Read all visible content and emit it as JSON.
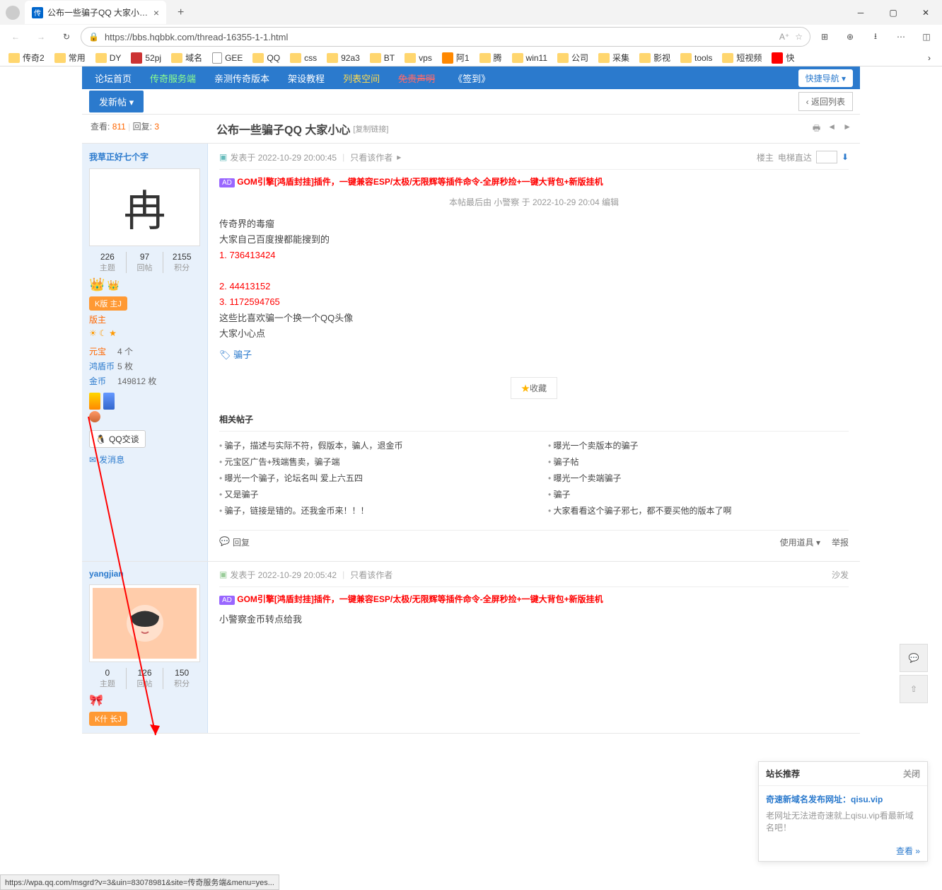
{
  "browser": {
    "tab_title": "公布一些骗子QQ 大家小心-传奇",
    "url": "https://bbs.hqbbk.com/thread-16355-1-1.html",
    "bookmarks": [
      "传奇2",
      "常用",
      "DY",
      "52pj",
      "域名",
      "GEE",
      "QQ",
      "css",
      "92a3",
      "BT",
      "vps",
      "阿1",
      "腾",
      "win11",
      "公司",
      "采集",
      "影视",
      "tools",
      "短视频",
      "快"
    ]
  },
  "forum_nav": {
    "home": "论坛首页",
    "svc": "传奇服务端",
    "test": "亲测传奇版本",
    "setup": "架设教程",
    "space": "列表空间",
    "declare": "免责声明",
    "signin": "《签到》",
    "quick": "快捷导航"
  },
  "subnav": {
    "newpost": "发新帖",
    "return": "‹ 返回列表"
  },
  "stats": {
    "view_lbl": "查看:",
    "view_num": "811",
    "reply_lbl": "回复:",
    "reply_num": "3",
    "title": "公布一些骗子QQ 大家小心",
    "copy": "[复制链接]"
  },
  "post1": {
    "username": "我草正好七个字",
    "date": "发表于 2022-10-29 20:00:45",
    "only_author": "只看该作者",
    "floor": "楼主",
    "elevator": "电梯直达",
    "ad": "GOM引擎[鸿盾封挂]插件，一键兼容ESP/太极/无限辉等插件命令-全屏秒捡+一键大背包+新版挂机",
    "edit_note": "本帖最后由 小警察 于 2022-10-29 20:04 编辑",
    "line1": "传奇界的毒瘤",
    "line2": "大家自己百度搜都能搜到的",
    "qq1": "1. 736413424",
    "qq2": "2. 44413152",
    "qq3": "3. 1172594765",
    "line3": "这些比喜欢骗一个换一个QQ头像",
    "line4": "大家小心点",
    "tag": "骗子",
    "fav": "收藏",
    "stats": {
      "threads": "226",
      "replies": "97",
      "points": "2155",
      "lbl_t": "主题",
      "lbl_r": "回帖",
      "lbl_p": "积分"
    },
    "badge": "K版 主J",
    "role": "版主",
    "props": {
      "yuanbao_k": "元宝",
      "yuanbao_v": "4 个",
      "hongdun_k": "鸿盾币",
      "hongdun_v": "5 枚",
      "gold_k": "金币",
      "gold_v": "149812 枚"
    },
    "qqchat": "QQ交谈",
    "sendmsg": "发消息",
    "related_title": "相关帖子",
    "related_left": [
      "骗子，描述与实际不符，假版本，骗人，退金币",
      "元宝区广告+残端售卖，骗子端",
      "曝光一个骗子，论坛名叫 爱上六五四",
      "又是骗子",
      "骗子，链接是错的。还我金币来！！！"
    ],
    "related_right": [
      "曝光一个卖版本的骗子",
      "骗子帖",
      "曝光一个卖端骗子",
      "骗子",
      "大家看看这个骗子邪七，都不要买他的版本了啊"
    ],
    "footer_reply": "回复",
    "footer_tool": "使用道具",
    "footer_report": "举报"
  },
  "post2": {
    "username": "yangjian",
    "date": "发表于 2022-10-29 20:05:42",
    "only_author": "只看该作者",
    "floor": "沙发",
    "ad": "GOM引擎[鸿盾封挂]插件，一键兼容ESP/太极/无限辉等插件命令-全屏秒捡+一键大背包+新版挂机",
    "content": "小警察金币转点给我",
    "stats": {
      "threads": "0",
      "replies": "126",
      "points": "150",
      "lbl_t": "主题",
      "lbl_r": "回帖",
      "lbl_p": "积分"
    },
    "badge": "K什 长J"
  },
  "recommend": {
    "title": "站长推荐",
    "close": "关闭",
    "link": "奇速新域名发布网址：qisu.vip",
    "desc": "老网址无法进奇速就上qisu.vip看最新域名吧！",
    "more": "查看 »"
  },
  "status_url": "https://wpa.qq.com/msgrd?v=3&uin=83078981&site=传奇服务端&menu=yes..."
}
